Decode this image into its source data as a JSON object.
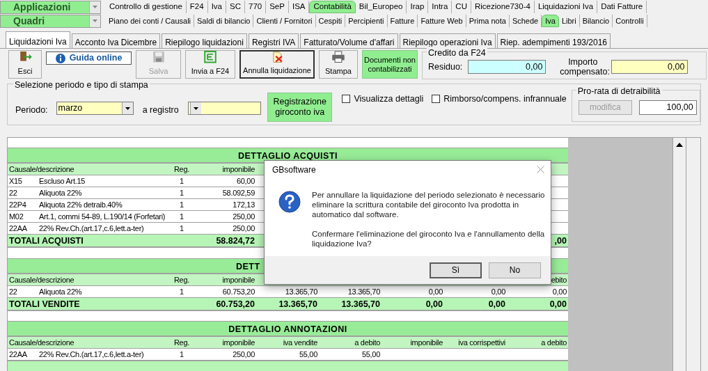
{
  "menu_bars": [
    {
      "label": "Applicazioni",
      "tabs": [
        {
          "label": "Controllo di gestione",
          "selected": false
        },
        {
          "label": "F24",
          "selected": false
        },
        {
          "label": "Iva",
          "selected": false
        },
        {
          "label": "SC",
          "selected": false
        },
        {
          "label": "770",
          "selected": false
        },
        {
          "label": "SeP",
          "selected": false
        },
        {
          "label": "ISA",
          "selected": false
        },
        {
          "label": "Contabilità",
          "selected": true
        },
        {
          "label": "Bil_Europeo",
          "selected": false
        },
        {
          "label": "Irap",
          "selected": false
        },
        {
          "label": "Intra",
          "selected": false
        },
        {
          "label": "CU",
          "selected": false
        },
        {
          "label": "Ricezione730-4",
          "selected": false
        },
        {
          "label": "Liquidazioni Iva",
          "selected": false
        },
        {
          "label": "Dati Fatture",
          "selected": false
        }
      ]
    },
    {
      "label": "Quadri",
      "tabs": [
        {
          "label": "Piano dei conti / Causali",
          "selected": false
        },
        {
          "label": "Saldi di bilancio",
          "selected": false
        },
        {
          "label": "Clienti / Fornitori",
          "selected": false
        },
        {
          "label": "Cespiti",
          "selected": false
        },
        {
          "label": "Percipienti",
          "selected": false
        },
        {
          "label": "Fatture",
          "selected": false
        },
        {
          "label": "Fatture Web",
          "selected": false
        },
        {
          "label": "Prima nota",
          "selected": false
        },
        {
          "label": "Schede",
          "selected": false
        },
        {
          "label": "Iva",
          "selected": true
        },
        {
          "label": "Libri",
          "selected": false
        },
        {
          "label": "Bilancio",
          "selected": false
        },
        {
          "label": "Controlli",
          "selected": false
        }
      ]
    }
  ],
  "page_tabs": [
    {
      "label": "Liquidazioni Iva",
      "selected": true
    },
    {
      "label": "Acconto Iva Dicembre",
      "selected": false
    },
    {
      "label": "Riepilogo liquidazioni",
      "selected": false
    },
    {
      "label": "Registri IVA",
      "selected": false
    },
    {
      "label": "Fatturato/Volume d'affari",
      "selected": false
    },
    {
      "label": "Riepilogo operazioni Iva",
      "selected": false
    },
    {
      "label": "Riep. adempimenti 193/2016",
      "selected": false
    }
  ],
  "toolbar": [
    {
      "kind": "exit",
      "label": "Esci",
      "disabled": false,
      "focused": false
    },
    {
      "kind": "help",
      "label": "Guida online"
    },
    {
      "kind": "save",
      "label": "Salva",
      "disabled": true,
      "focused": false
    },
    {
      "kind": "f24",
      "label": "Invia a F24",
      "disabled": false,
      "focused": false
    },
    {
      "kind": "cancel",
      "label": "Annulla liquidazione",
      "disabled": false,
      "focused": true
    },
    {
      "kind": "print",
      "label": "Stampa",
      "disabled": false,
      "focused": false
    },
    {
      "kind": "docs",
      "label": "Documenti non contabilizzati"
    }
  ],
  "credit": {
    "title": "Credito da F24",
    "fields": [
      {
        "kind": "residuo",
        "label": "Residuo:",
        "value": "0,00"
      },
      {
        "kind": "compensato",
        "label": "Importo compensato:",
        "value": "0,00"
      }
    ]
  },
  "selection": {
    "title": "Selezione periodo e tipo di stampa",
    "period_label": "Periodo:",
    "period_value": "marzo",
    "register_label": "a registro",
    "post_button": "Registrazione giroconto iva",
    "checkboxes": [
      {
        "label": "Visualizza dettagli",
        "checked": false
      },
      {
        "label": "Rimborso/compens. infrannuale",
        "checked": false
      }
    ],
    "prorata": {
      "title": "Pro-rata di detraibilità",
      "button": "modifica",
      "button_disabled": true,
      "value": "100,00"
    }
  },
  "table": {
    "sections": [
      {
        "title": "DETTAGLIO ACQUISTI",
        "header": {
          "code": "Causale/descrizione",
          "reg": "Reg.",
          "imponibile": "imponibile"
        },
        "rows": [
          {
            "code": "X15",
            "description": "Escluso Art.15",
            "reg": "1",
            "imponibile": "60,00"
          },
          {
            "code": "22",
            "description": "Aliquota 22%",
            "reg": "1",
            "imponibile": "58.092,59"
          },
          {
            "code": "22P4",
            "description": "Aliquota 22% detraib.40%",
            "reg": "1",
            "imponibile": "172,13"
          },
          {
            "code": "M02",
            "description": "Art.1, commi 54-89, L.190/14 (Forfetari)",
            "reg": "1",
            "imponibile": "250,00"
          },
          {
            "code": "22AA",
            "description": "22% Rev.Ch.(art.17,c.6,lett.a-ter)",
            "reg": "1",
            "imponibile": "250,00"
          }
        ],
        "totals": {
          "code": "TOTALI ACQUISTI",
          "imponibile": "58.824,72",
          "column_9": ",00"
        }
      },
      {
        "title": "DETT",
        "header": {
          "code": "Causale/descrizione",
          "reg": "Reg.",
          "imponibile": "imponibile",
          "column_9": "ebito"
        },
        "rows": [
          {
            "code": "22",
            "description": "Aliquota 22%",
            "reg": "1",
            "imponibile": "60.753,20",
            "column_5": "13.365,70",
            "column_6": "13.365,70",
            "column_7": "0,00",
            "column_8": "0,00",
            "column_9": "0,00"
          }
        ],
        "totals": {
          "code": "TOTALI VENDITE",
          "imponibile": "60.753,20",
          "column_5": "13.365,70",
          "column_6": "13.365,70",
          "column_7": "0,00",
          "column_8": "0,00",
          "column_9": "0,00"
        }
      },
      {
        "title": "DETTAGLIO ANNOTAZIONI",
        "header": {
          "code": "Causale/descrizione",
          "reg": "Reg.",
          "imponibile": "imponibile",
          "column_5": "iva vendite",
          "column_6": "a debito",
          "column_7": "imponibile",
          "column_8": "iva corrispettivi",
          "column_9": "a debito"
        },
        "rows": [
          {
            "code": "22AA",
            "description": "22% Rev.Ch.(art.17,c.6,lett.a-ter)",
            "reg": "1",
            "imponibile": "250,00",
            "column_5": "55,00",
            "column_6": "55,00"
          }
        ]
      }
    ]
  },
  "dialog": {
    "title": "GBsoftware",
    "paragraphs": [
      "Per annullare la liquidazione del periodo selezionato è necessario eliminare la scrittura contabile del giroconto Iva prodotta in automatico dal software.",
      "Confermare l'eliminazione del giroconto Iva e l'annullamento della liquidazione Iva?"
    ],
    "buttons": [
      {
        "label": "Sì",
        "default": true
      },
      {
        "label": "No",
        "default": false
      }
    ]
  }
}
